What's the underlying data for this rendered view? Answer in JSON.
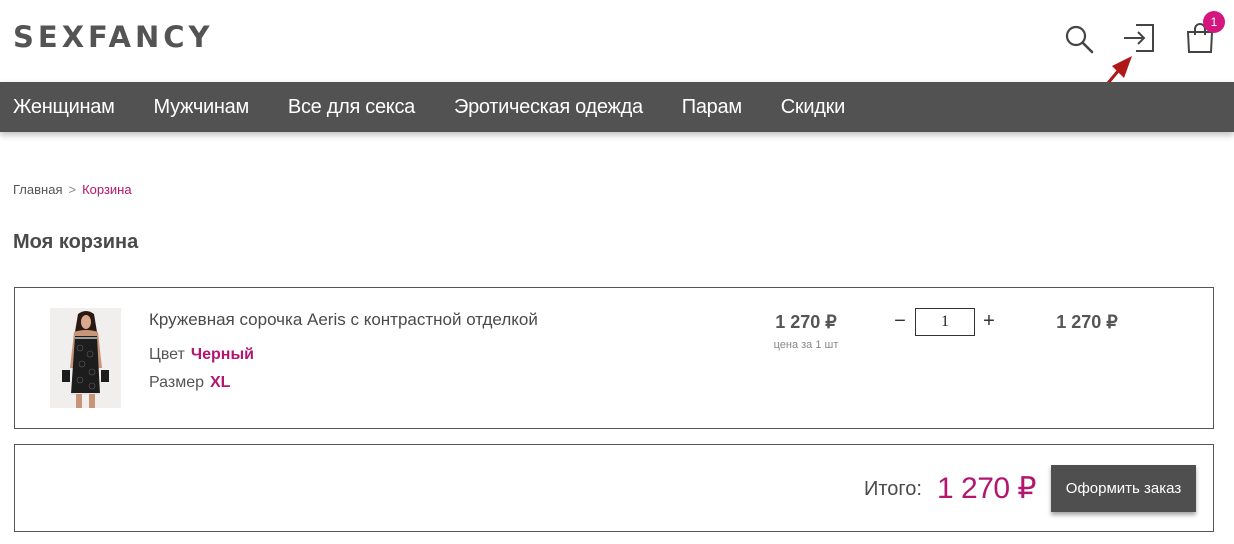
{
  "header": {
    "logo": "SEXFANCY",
    "cart_count": "1",
    "icons": [
      "search-icon",
      "login-icon",
      "cart-icon"
    ]
  },
  "nav": {
    "items": [
      "Женщинам",
      "Мужчинам",
      "Все для секса",
      "Эротическая одежда",
      "Парам",
      "Скидки"
    ]
  },
  "breadcrumb": {
    "home": "Главная",
    "separator": ">",
    "current": "Корзина"
  },
  "page_title": "Моя корзина",
  "cart": {
    "items": [
      {
        "name": "Кружевная сорочка Aeris с контрастной отделкой",
        "color_label": "Цвет",
        "color_value": "Черный",
        "size_label": "Размер",
        "size_value": "XL",
        "unit_price": "1 270 ₽",
        "unit_note": "цена за 1 шт",
        "qty_minus": "−",
        "quantity": "1",
        "qty_plus": "+",
        "line_total": "1 270 ₽"
      }
    ]
  },
  "summary": {
    "total_label": "Итого:",
    "total_value": "1 270 ₽",
    "checkout_label": "Оформить заказ"
  },
  "colors": {
    "accent": "#b3166d",
    "badge": "#d4167f",
    "nav_bg": "#525252",
    "button_bg": "#4f4f4f"
  }
}
